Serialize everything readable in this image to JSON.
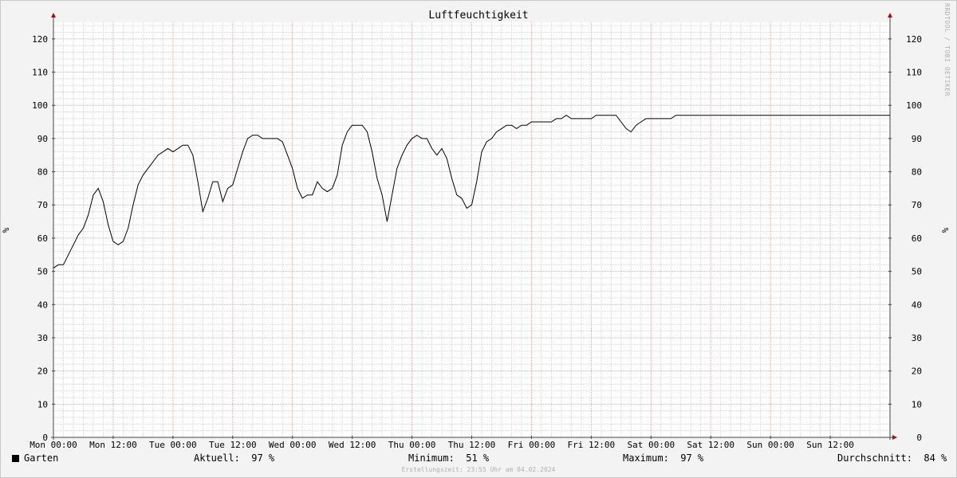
{
  "chart_data": {
    "type": "line",
    "title": "Luftfeuchtigkeit",
    "ylabel": "%",
    "ylim": [
      0,
      125
    ],
    "yticks": [
      0,
      10,
      20,
      30,
      40,
      50,
      60,
      70,
      80,
      90,
      100,
      110,
      120
    ],
    "xticks": [
      "Mon 00:00",
      "Mon 12:00",
      "Tue 00:00",
      "Tue 12:00",
      "Wed 00:00",
      "Wed 12:00",
      "Thu 00:00",
      "Thu 12:00",
      "Fri 00:00",
      "Fri 12:00",
      "Sat 00:00",
      "Sat 12:00",
      "Sun 00:00",
      "Sun 12:00"
    ],
    "xlim_hours": [
      0,
      168
    ],
    "grid": true,
    "series": [
      {
        "name": "Garten",
        "color": "#000000",
        "x_hours": [
          0,
          1,
          2,
          3,
          4,
          5,
          6,
          7,
          8,
          9,
          10,
          11,
          12,
          13,
          14,
          15,
          16,
          17,
          18,
          19,
          20,
          21,
          22,
          23,
          24,
          25,
          26,
          27,
          28,
          29,
          30,
          31,
          32,
          33,
          34,
          35,
          36,
          37,
          38,
          39,
          40,
          41,
          42,
          43,
          44,
          45,
          46,
          47,
          48,
          49,
          50,
          51,
          52,
          53,
          54,
          55,
          56,
          57,
          58,
          59,
          60,
          61,
          62,
          63,
          64,
          65,
          66,
          67,
          68,
          69,
          70,
          71,
          72,
          73,
          74,
          75,
          76,
          77,
          78,
          79,
          80,
          81,
          82,
          83,
          84,
          85,
          86,
          87,
          88,
          89,
          90,
          91,
          92,
          93,
          94,
          95,
          96,
          97,
          98,
          99,
          100,
          101,
          102,
          103,
          104,
          105,
          106,
          107,
          108,
          109,
          110,
          111,
          112,
          113,
          114,
          115,
          116,
          117,
          118,
          119,
          120,
          121,
          122,
          123,
          124,
          125,
          126,
          127,
          128,
          129,
          130,
          131,
          132,
          133,
          134,
          135,
          136,
          137,
          138,
          139,
          140,
          141,
          142,
          143,
          144,
          145,
          146,
          147,
          148,
          149,
          150,
          151,
          152,
          153,
          154,
          155,
          156,
          157,
          158,
          159,
          160,
          161,
          162,
          163,
          164,
          165,
          166,
          167,
          168
        ],
        "values": [
          51,
          52,
          52,
          55,
          58,
          61,
          63,
          67,
          73,
          75,
          71,
          64,
          59,
          58,
          59,
          63,
          70,
          76,
          79,
          81,
          83,
          85,
          86,
          87,
          86,
          87,
          88,
          88,
          85,
          77,
          68,
          72,
          77,
          77,
          71,
          75,
          76,
          81,
          86,
          90,
          91,
          91,
          90,
          90,
          90,
          90,
          89,
          85,
          81,
          75,
          72,
          73,
          73,
          77,
          75,
          74,
          75,
          79,
          88,
          92,
          94,
          94,
          94,
          92,
          86,
          78,
          73,
          65,
          73,
          81,
          85,
          88,
          90,
          91,
          90,
          90,
          87,
          85,
          87,
          84,
          78,
          73,
          72,
          69,
          70,
          77,
          86,
          89,
          90,
          92,
          93,
          94,
          94,
          93,
          94,
          94,
          95,
          95,
          95,
          95,
          95,
          96,
          96,
          97,
          96,
          96,
          96,
          96,
          96,
          97,
          97,
          97,
          97,
          97,
          95,
          93,
          92,
          94,
          95,
          96,
          96,
          96,
          96,
          96,
          96,
          97,
          97,
          97,
          97,
          97,
          97,
          97,
          97,
          97,
          97,
          97,
          97,
          97,
          97,
          97,
          97,
          97,
          97,
          97,
          97,
          97,
          97,
          97,
          97,
          97,
          97,
          97,
          97,
          97,
          97,
          97,
          97,
          97,
          97,
          97,
          97,
          97,
          97,
          97,
          97,
          97,
          97,
          97,
          97
        ]
      }
    ]
  },
  "legend": {
    "series_name": "Garten",
    "current_label": "Aktuell:",
    "current_value": "97 %",
    "min_label": "Minimum:",
    "min_value": "51 %",
    "max_label": "Maximum:",
    "max_value": "97 %",
    "avg_label": "Durchschnitt:",
    "avg_value": "84 %"
  },
  "footer_text": "Erstellungszeit: 23:55 Uhr am 04.02.2024",
  "watermark_text": "RRDTOOL / TOBI OETIKER"
}
